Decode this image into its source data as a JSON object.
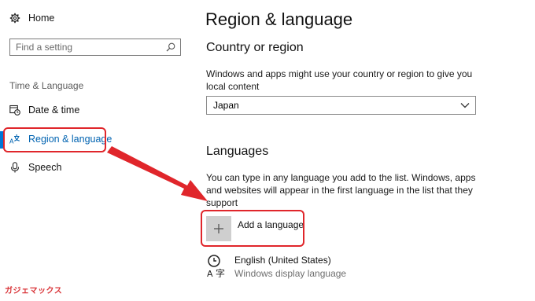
{
  "sidebar": {
    "home_label": "Home",
    "search_placeholder": "Find a setting",
    "group_label": "Time & Language",
    "items": [
      {
        "label": "Date & time",
        "icon": "calendar-clock-icon"
      },
      {
        "label": "Region & language",
        "icon": "region-language-icon",
        "active": true
      },
      {
        "label": "Speech",
        "icon": "microphone-icon"
      }
    ]
  },
  "main": {
    "title": "Region & language",
    "country_heading": "Country or region",
    "country_desc_line1": "Windows and apps might use your country or region to give you",
    "country_desc_line2": "local content",
    "country_value": "Japan",
    "languages_heading": "Languages",
    "languages_desc_line1": "You can type in any language you add to the list. Windows, apps",
    "languages_desc_line2": "and websites will appear in the first language in the list that they",
    "languages_desc_line3": "support",
    "add_language_label": "Add a language",
    "language_item": {
      "name": "English (United States)",
      "subtitle": "Windows display language",
      "icon_char": "字"
    }
  },
  "annotation": {
    "highlight_color": "#e0262b",
    "watermark": "ガジェマックス"
  },
  "colors": {
    "accent": "#0078d7",
    "active_text": "#0063b1"
  }
}
